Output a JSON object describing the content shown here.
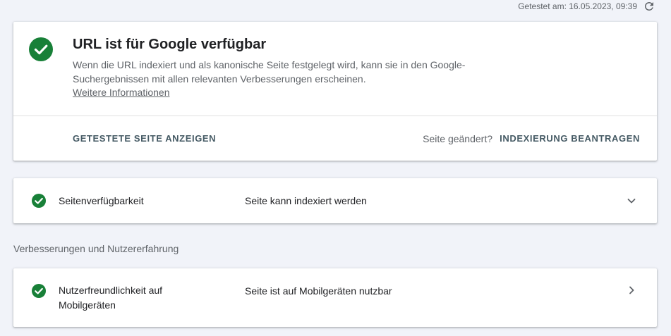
{
  "header": {
    "tested_text": "Getestet am: 16.05.2023, 09:39",
    "refresh_icon": "refresh-icon"
  },
  "colors": {
    "success_green": "#188038",
    "action_text": "#455a64",
    "background": "#f1f3f9"
  },
  "main_card": {
    "title": "URL ist für Google verfügbar",
    "description": "Wenn die URL indexiert und als kanonische Seite festgelegt wird, kann sie in den Google-Suchergebnissen mit allen relevanten Verbesserungen erscheinen.",
    "link": "Weitere Informationen",
    "view_button": "GETESTETE SEITE ANZEIGEN",
    "changed_text": "Seite geändert?",
    "index_button": "INDEXIERUNG BEANTRAGEN",
    "icon": "check-circle-icon"
  },
  "availability": {
    "label": "Seitenverfügbarkeit",
    "value": "Seite kann indexiert werden",
    "icon": "check-circle-icon",
    "chevron": "chevron-down-icon"
  },
  "enhancements": {
    "title": "Verbesserungen und Nutzererfahrung",
    "items": [
      {
        "label": "Nutzerfreundlichkeit auf Mobilgeräten",
        "value": "Seite ist auf Mobilgeräten nutzbar",
        "icon": "check-circle-icon",
        "chevron": "chevron-right-icon"
      }
    ]
  }
}
